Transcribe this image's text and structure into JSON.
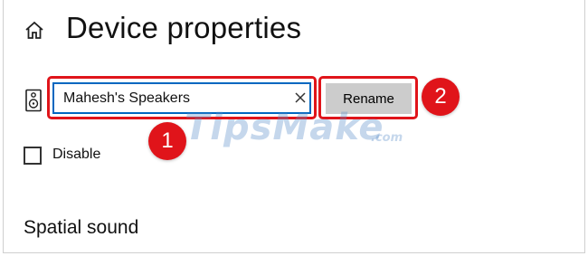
{
  "header": {
    "title": "Device properties",
    "home_icon": "home-icon"
  },
  "device": {
    "icon": "speaker-icon",
    "name_value": "Mahesh's Speakers",
    "clear_icon": "close-icon",
    "rename_label": "Rename"
  },
  "disable": {
    "label": "Disable",
    "checked": false
  },
  "spatial_sound": {
    "heading": "Spatial sound"
  },
  "annotations": {
    "step1": "1",
    "step2": "2",
    "color": "#e0141a"
  },
  "watermark": {
    "text": "TipsMake",
    "suffix": ".com"
  },
  "colors": {
    "input_border": "#0067c0",
    "button_bg": "#cccccc"
  }
}
